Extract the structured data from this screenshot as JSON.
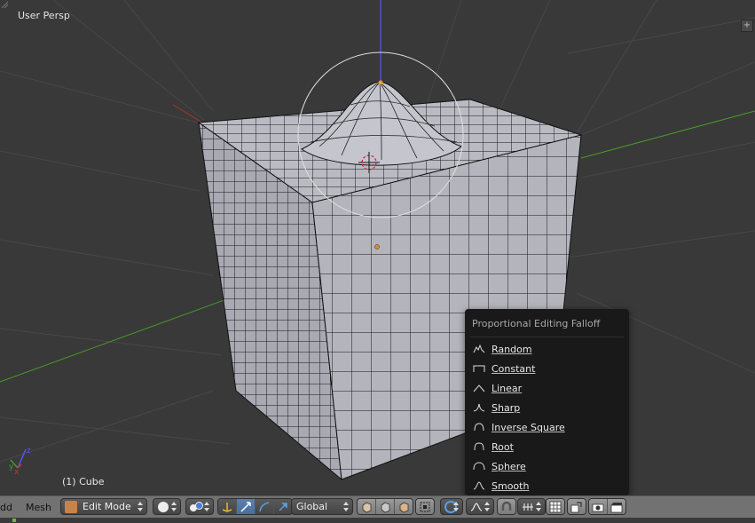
{
  "viewport": {
    "view_label": "User Persp",
    "object_label": "(1) Cube"
  },
  "popup": {
    "title": "Proportional Editing Falloff",
    "items": [
      {
        "label": "Random",
        "icon": "random-falloff-icon"
      },
      {
        "label": "Constant",
        "icon": "constant-falloff-icon"
      },
      {
        "label": "Linear",
        "icon": "linear-falloff-icon"
      },
      {
        "label": "Sharp",
        "icon": "sharp-falloff-icon"
      },
      {
        "label": "Inverse Square",
        "icon": "inverse-square-falloff-icon"
      },
      {
        "label": "Root",
        "icon": "root-falloff-icon"
      },
      {
        "label": "Sphere",
        "icon": "sphere-falloff-icon"
      },
      {
        "label": "Smooth",
        "icon": "smooth-falloff-icon"
      }
    ]
  },
  "header": {
    "add_label": "dd",
    "mesh_label": "Mesh",
    "mode": "Edit Mode",
    "orientation": "Global"
  },
  "colors": {
    "viewport_bg": "#393939",
    "header_bg": "#727272",
    "menu_bg": "#191919",
    "active_button": "#5b7fb4",
    "x_axis": "#a33",
    "y_axis": "#4a9a2c",
    "z_axis": "#5555ee"
  }
}
